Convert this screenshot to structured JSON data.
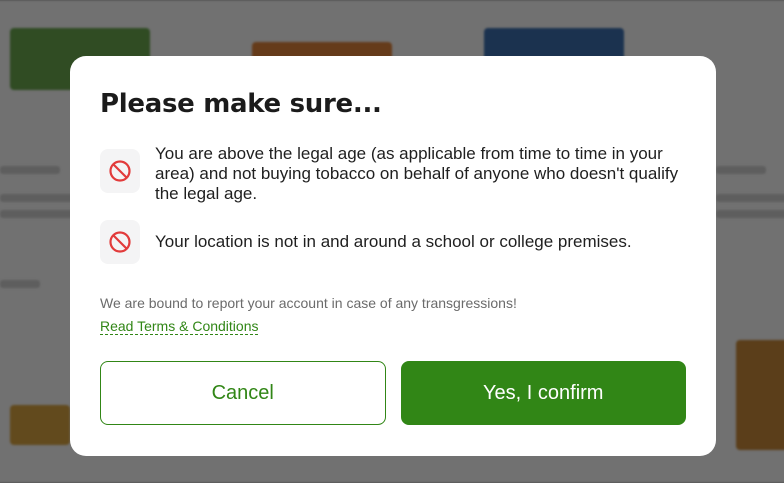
{
  "modal": {
    "title": "Please make sure...",
    "rules": [
      {
        "icon": "prohibited-icon",
        "text": "You are above the legal age (as applicable from time to time in your area) and not buying tobacco on behalf of anyone who doesn't qualify the legal age."
      },
      {
        "icon": "prohibited-icon",
        "text": "Your location is not in and around a school or college premises."
      }
    ],
    "notice": "We are bound to report your account in case of any transgressions!",
    "terms_link": "Read Terms & Conditions",
    "cancel_label": "Cancel",
    "confirm_label": "Yes, I confirm"
  },
  "colors": {
    "brand_green": "#318616",
    "prohibit_red": "#e23b3b",
    "overlay": "rgba(0,0,0,0.55)"
  }
}
